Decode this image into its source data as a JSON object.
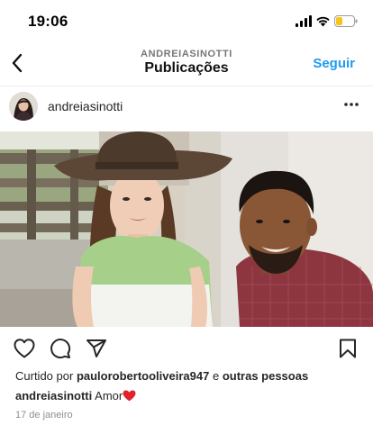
{
  "status_bar": {
    "time": "19:06"
  },
  "header": {
    "username": "ANDREIASINOTTI",
    "title": "Publicações",
    "follow_label": "Seguir"
  },
  "post": {
    "username": "andreiasinotti",
    "liked_by_prefix": "Curtido por",
    "liked_by_user": "paulorobertooliveira947",
    "liked_by_joiner": "e",
    "liked_by_others": "outras pessoas",
    "caption_user": "andreiasinotti",
    "caption_text": "Amor",
    "date": "17 de janeiro"
  },
  "icons": {
    "back": "chevron-left-icon",
    "more": "more-horizontal-icon",
    "like": "heart-icon",
    "comment": "comment-icon",
    "share": "send-icon",
    "save": "bookmark-icon",
    "caption_emoji": "red-heart-icon"
  },
  "colors": {
    "accent": "#1e9bf0",
    "heart": "#e0242c",
    "battery": "#f5c518"
  }
}
